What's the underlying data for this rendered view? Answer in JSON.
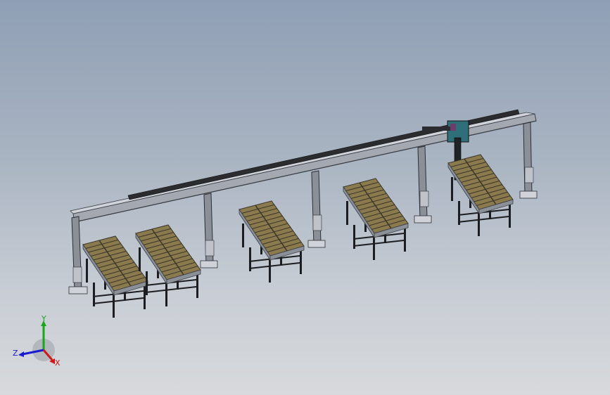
{
  "viewport": {
    "background_top": "#8f9fb5",
    "background_bottom": "#d7d9dc"
  },
  "model": {
    "frame_color": "#8a8f98",
    "frame_dark": "#3b3f45",
    "roller_color": "#8a7a4e",
    "roller_dark": "#3a3527",
    "leg_color": "#1c1d20",
    "trolley_color": "#2e6f7a"
  },
  "triad": {
    "x_label": "X",
    "y_label": "Y",
    "z_label": "Z",
    "x_color": "#d01818",
    "y_color": "#1aa51a",
    "z_color": "#1a1ad0"
  }
}
